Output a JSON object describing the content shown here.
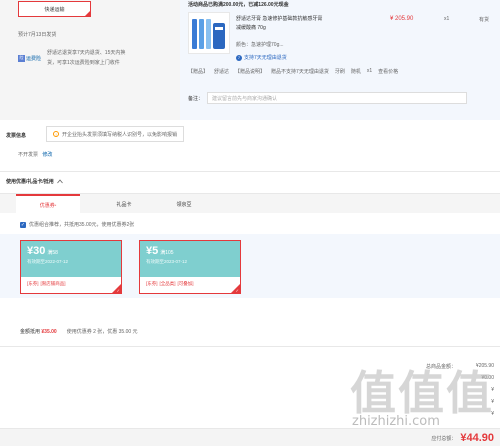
{
  "shipping": {
    "express_button": "快递运输",
    "eta": "预计7月13日发货",
    "service_badge": "运费险",
    "service_text": "舒适达退货享7天内退货、15天内换货，可享1次运费险到家上门收件"
  },
  "order": {
    "promo": "活动商品已购满200.00元，已减126.00元现金",
    "product": {
      "title": "舒适达牙膏 急速修护基础款抗敏感牙膏 减缓酸痛 70g",
      "color_label": "颜色：",
      "color_value": "急速护理70g...",
      "return_policy": "支持7天无理由退货",
      "price": "¥ 205.90",
      "qty": "x1",
      "stock": "有货"
    },
    "gift_line": [
      "【赠品】",
      "舒适达",
      "【赠品说明】",
      "赠品不支持7天无理由退货",
      "牙刷",
      "随机",
      "x1",
      "查看价格"
    ],
    "remark_label": "备注：",
    "remark_placeholder": "建议留言前先与商家沟通确认"
  },
  "invoice": {
    "title": "发票信息",
    "tip": "开企业抬头发票须填写纳税人识别号，以免影响报销",
    "status": "不开发票",
    "edit_link": "修改"
  },
  "coupons": {
    "title": "使用优惠/礼品卡/抵用",
    "collapse_icon": "chevron-up",
    "tabs": [
      {
        "label": "优惠券",
        "active": true,
        "star": "*"
      },
      {
        "label": "礼品卡",
        "active": false,
        "star": ""
      },
      {
        "label": "领京豆",
        "active": false,
        "star": ""
      }
    ],
    "combo_text": "优惠组合推荐，共抵用35.00元，使用优惠券2张",
    "items": [
      {
        "amount": "¥30",
        "condition": "满58",
        "valid": "有效期至2022-07-12",
        "tags": [
          "[东券]",
          "[限店铺商品]"
        ]
      },
      {
        "amount": "¥5",
        "condition": "满105",
        "valid": "有效期至2023-07-12",
        "tags": [
          "[东券]",
          "[全品类]",
          "[可叠加]"
        ]
      }
    ],
    "discount_label": "金额抵用",
    "discount_amount": "¥35.00",
    "used_info": "使用优惠券 2 张，优惠 35.00 元"
  },
  "summary": {
    "rows": [
      {
        "label": "总商品金额：",
        "value": "¥205.90"
      },
      {
        "label": "",
        "value": "¥0.00"
      },
      {
        "label": "",
        "value": "¥"
      },
      {
        "label": "",
        "value": "¥"
      },
      {
        "label": "",
        "value": "¥"
      }
    ],
    "payable_label": "应付总额：",
    "payable_amount": "¥44.90"
  },
  "watermark": {
    "brand": "值值值",
    "url": "zhizhizhi.com"
  },
  "colors": {
    "accent": "#e4393c",
    "coupon": "#7fcfcf",
    "link": "#005ea7"
  }
}
